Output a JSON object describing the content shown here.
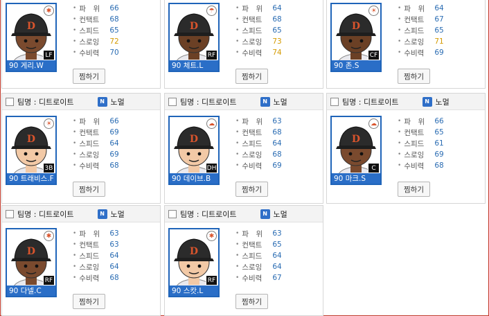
{
  "team_label": "팀명 : 디트로이트",
  "badge_letter": "N",
  "grade_label": "노멀",
  "button_label": "찜하기",
  "stat_labels": [
    "파　위",
    "컨택트",
    "스피드",
    "스로잉",
    "수비력"
  ],
  "colors": {
    "accent": "#2a6ec7",
    "stat_value": "#2a6cb3",
    "stat_high": "#d49a00"
  },
  "cards": [
    {
      "name": "90 게리.W",
      "pos": "LF",
      "weather": "snow-icon",
      "skin": "#7a4a2e",
      "stats": [
        "66",
        "68",
        "65",
        "72",
        "70"
      ],
      "high": [
        false,
        false,
        false,
        true,
        false
      ]
    },
    {
      "name": "90 체트.L",
      "pos": "RF",
      "weather": "umbrella-icon",
      "skin": "#6b4025",
      "stats": [
        "64",
        "68",
        "65",
        "73",
        "74"
      ],
      "high": [
        false,
        false,
        false,
        true,
        true
      ]
    },
    {
      "name": "90 존.S",
      "pos": "CF",
      "weather": "sun-icon",
      "skin": "#6b4025",
      "stats": [
        "64",
        "67",
        "65",
        "71",
        "69"
      ],
      "high": [
        false,
        false,
        false,
        true,
        false
      ]
    },
    {
      "name": "90 트래비스.F",
      "pos": "3B",
      "weather": "sun-icon",
      "skin": "#f2c9a6",
      "stats": [
        "66",
        "69",
        "64",
        "69",
        "68"
      ],
      "high": [
        false,
        false,
        false,
        false,
        false
      ]
    },
    {
      "name": "90 데이브.B",
      "pos": "DH",
      "weather": "cloud-icon",
      "skin": "#f2c9a6",
      "stats": [
        "63",
        "68",
        "64",
        "68",
        "69"
      ],
      "high": [
        false,
        false,
        false,
        false,
        false
      ]
    },
    {
      "name": "90 마크.S",
      "pos": "C",
      "weather": "cloud-icon",
      "skin": "#7a4a2e",
      "stats": [
        "66",
        "65",
        "61",
        "69",
        "68"
      ],
      "high": [
        false,
        false,
        false,
        false,
        false
      ]
    },
    {
      "name": "90 다넬.C",
      "pos": "RF",
      "weather": "snow-icon",
      "skin": "#7a4a2e",
      "stats": [
        "63",
        "63",
        "64",
        "64",
        "68"
      ],
      "high": [
        false,
        false,
        false,
        false,
        false
      ]
    },
    {
      "name": "90 스캇.L",
      "pos": "RF",
      "weather": "snow-icon",
      "skin": "#f2c9a6",
      "stats": [
        "63",
        "65",
        "64",
        "64",
        "67"
      ],
      "high": [
        false,
        false,
        false,
        false,
        false
      ]
    }
  ]
}
